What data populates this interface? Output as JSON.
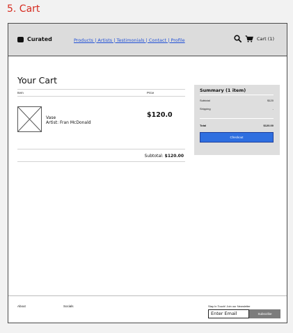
{
  "doc_title": "5. Cart",
  "navbar": {
    "logo": "Curated",
    "links": "Products | Artists | Testimonials | Contact | Profile",
    "cart_label": "Cart (1)",
    "icons": [
      "search-icon",
      "cart-icon"
    ]
  },
  "cart": {
    "heading": "Your Cart",
    "col_item": "Item",
    "col_price": "Price",
    "item": {
      "name": "Vase",
      "artist": "Artist: Fran McDonald",
      "price": "$120.0"
    },
    "subtotal_label": "Subtotal:",
    "subtotal_value": "$120.00"
  },
  "summary": {
    "title": "Summary (1 item)",
    "subtotal_label": "Subtotal",
    "subtotal_value": "$120",
    "shipping_label": "Shipping",
    "shipping_value": "-",
    "total_label": "Total",
    "total_value": "$120.00",
    "checkout": "Checkout"
  },
  "footer": {
    "about": "About",
    "socials": "Socials",
    "newsletter_label": "Stay In Touch! Join our Newsletter",
    "email_value": "Enter Email",
    "subscribe": "Subscribe"
  },
  "colors": {
    "title_red": "#d62b1f",
    "link_blue": "#1f4fd6",
    "checkout_blue": "#2f6fe0",
    "subscribe_gray": "#7c7c7c"
  }
}
